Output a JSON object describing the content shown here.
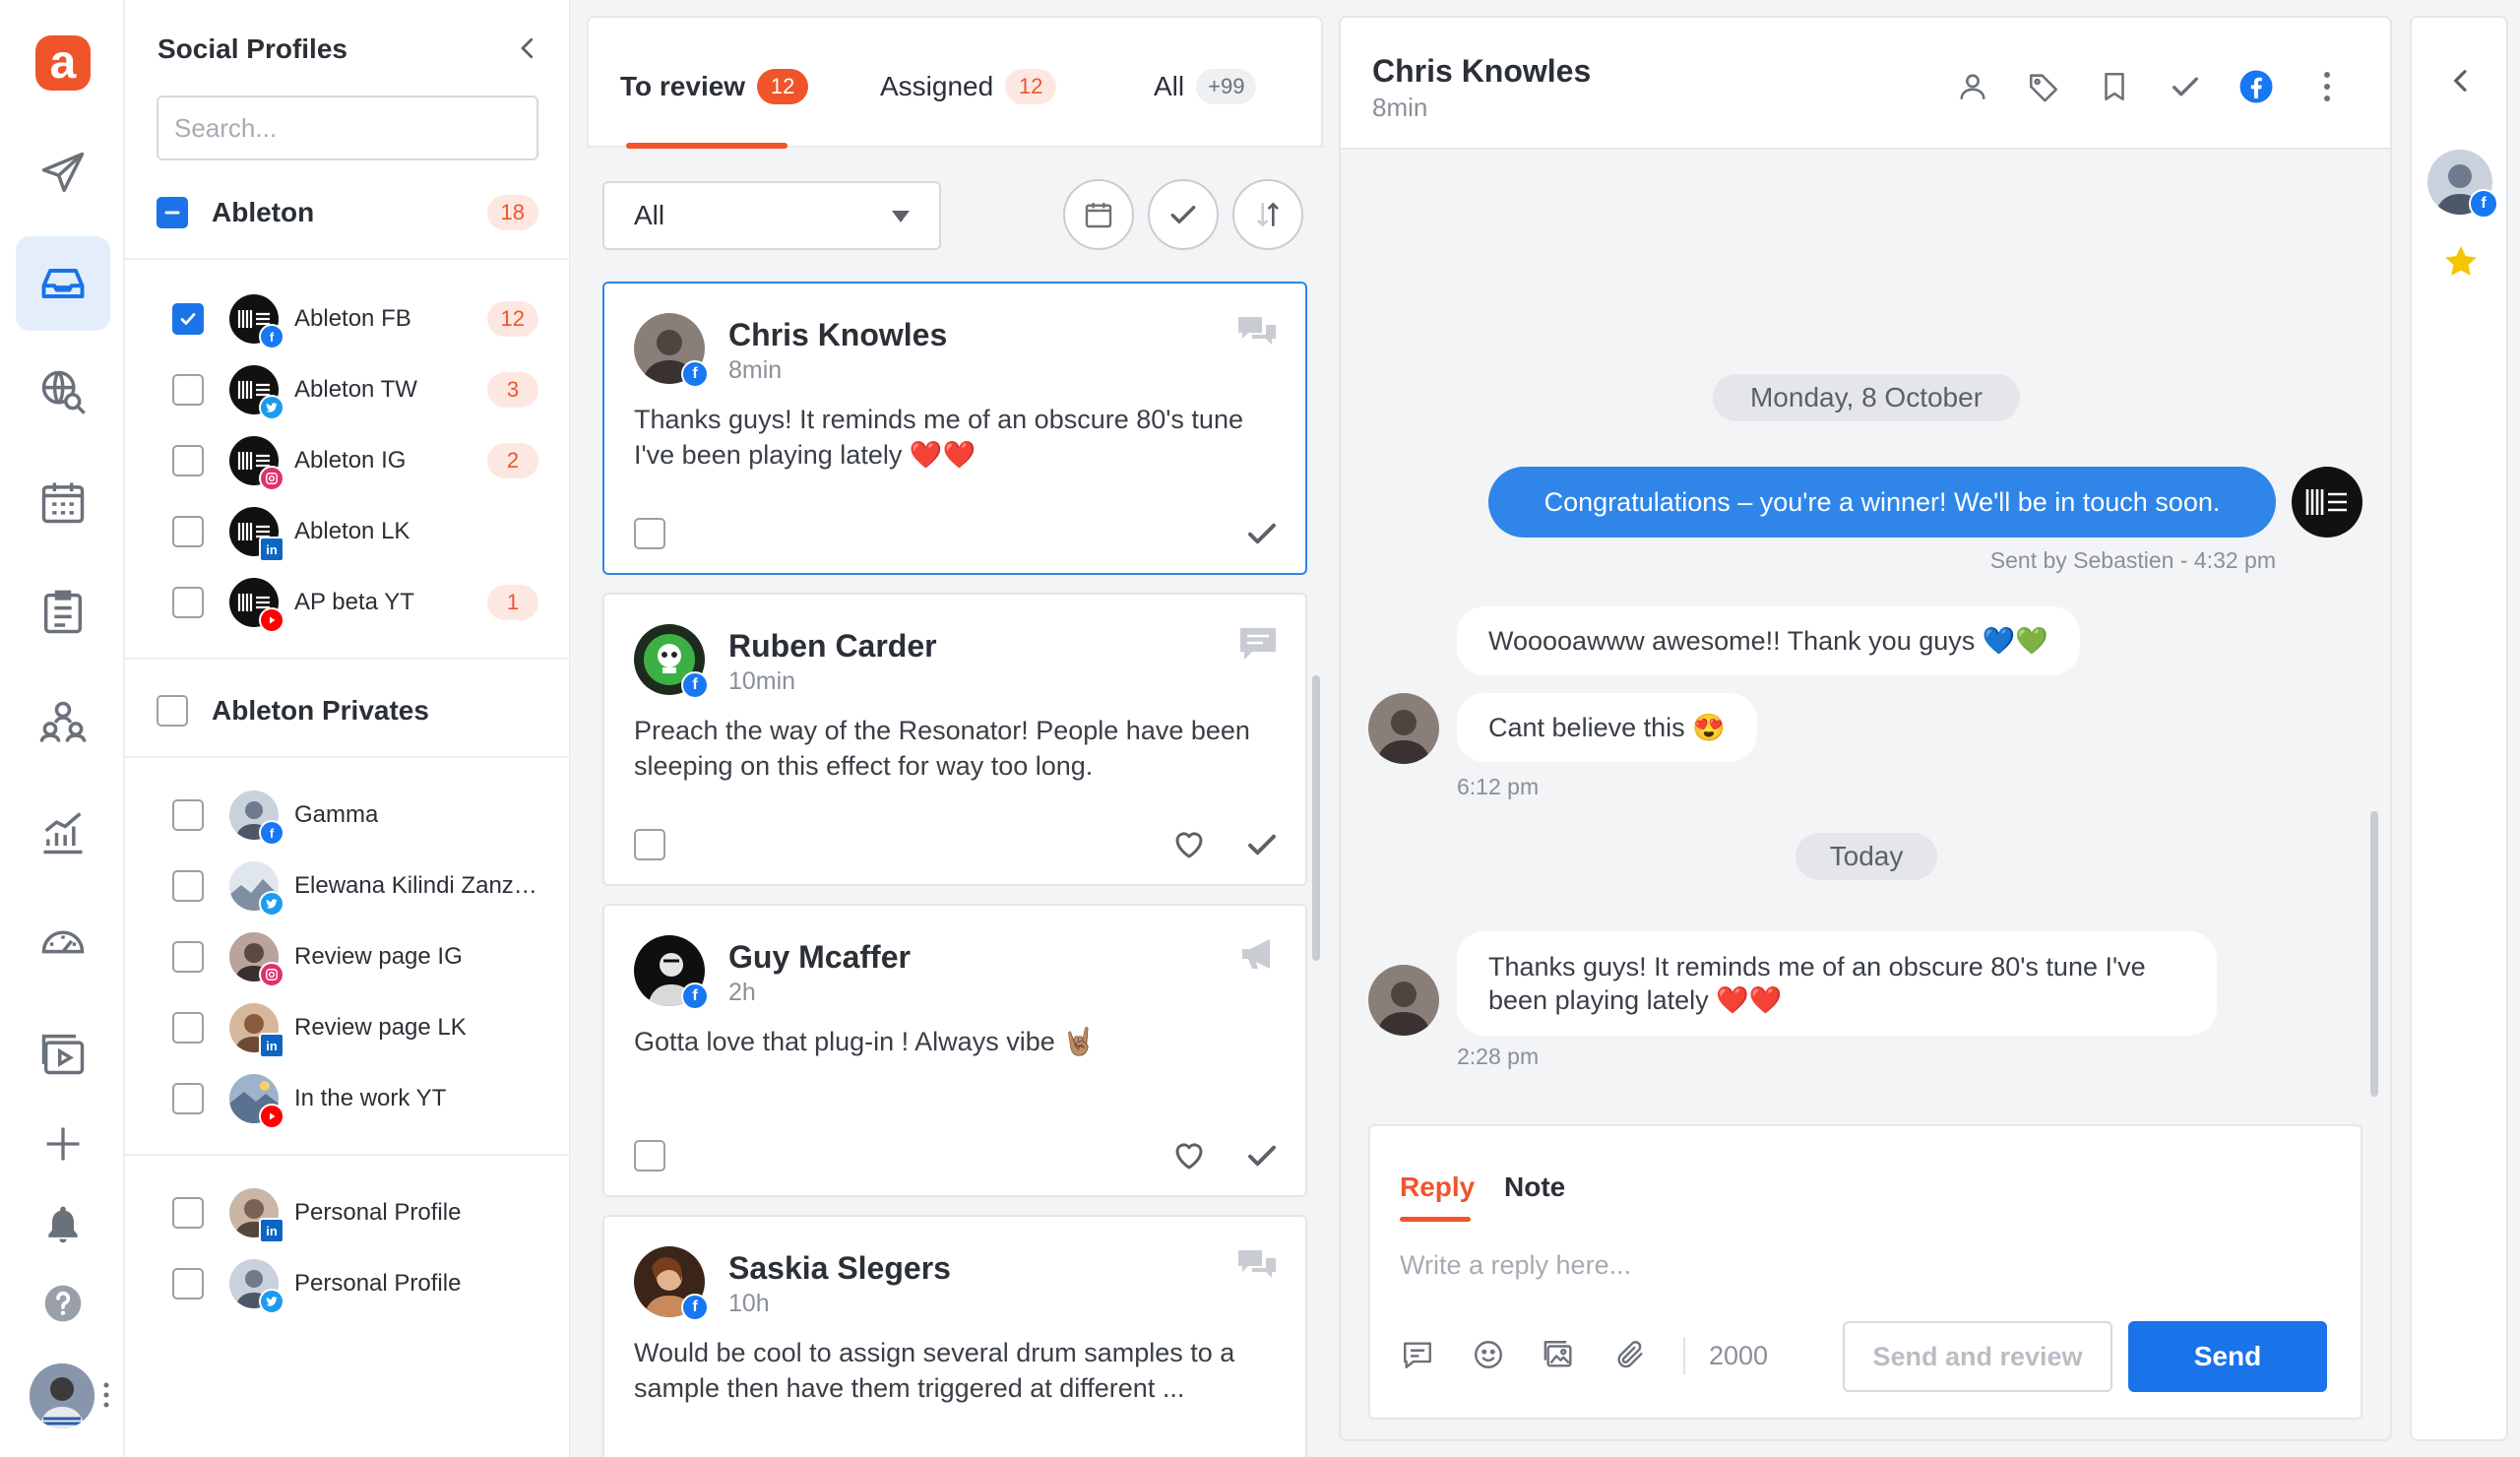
{
  "brand": {
    "logo_letter": "a",
    "accent": "#f0542b",
    "primary": "#1a73e8"
  },
  "rail": {
    "items": [
      {
        "icon": "paper-plane-icon"
      },
      {
        "icon": "inbox-icon",
        "active": true
      },
      {
        "icon": "globe-search-icon"
      },
      {
        "icon": "calendar-icon"
      },
      {
        "icon": "clipboard-list-icon"
      },
      {
        "icon": "team-icon"
      },
      {
        "icon": "bar-chart-icon"
      },
      {
        "icon": "speedometer-icon"
      },
      {
        "icon": "media-library-icon"
      },
      {
        "icon": "plus-icon"
      },
      {
        "icon": "bell-icon"
      },
      {
        "icon": "help-icon"
      }
    ]
  },
  "profiles": {
    "title": "Social Profiles",
    "search_placeholder": "Search...",
    "group1": {
      "name": "Ableton",
      "count": "18"
    },
    "group1_items": [
      {
        "label": "Ableton FB",
        "network": "facebook",
        "badge": "12",
        "checked": true
      },
      {
        "label": "Ableton TW",
        "network": "twitter",
        "badge": "3"
      },
      {
        "label": "Ableton IG",
        "network": "instagram",
        "badge": "2"
      },
      {
        "label": "Ableton LK",
        "network": "linkedin",
        "badge": ""
      },
      {
        "label": "AP beta YT",
        "network": "youtube",
        "badge": "1"
      }
    ],
    "group2": {
      "name": "Ableton Privates"
    },
    "group2_items": [
      {
        "label": "Gamma",
        "network": "facebook"
      },
      {
        "label": "Elewana Kilindi Zanzi...",
        "network": "twitter"
      },
      {
        "label": "Review page IG",
        "network": "instagram"
      },
      {
        "label": "Review page LK",
        "network": "linkedin"
      },
      {
        "label": "In the work YT",
        "network": "youtube"
      }
    ],
    "group3_items": [
      {
        "label": "Personal Profile",
        "network": "linkedin"
      },
      {
        "label": "Personal Profile",
        "network": "twitter"
      }
    ]
  },
  "feed": {
    "tabs": [
      {
        "label": "To review",
        "badge": "12"
      },
      {
        "label": "Assigned",
        "badge": "12"
      },
      {
        "label": "All",
        "badge": "+99"
      }
    ],
    "filter_value": "All",
    "cards": [
      {
        "name": "Chris Knowles",
        "time": "8min",
        "text": "Thanks guys! It reminds me of an obscure 80's tune I've been playing lately ❤️❤️"
      },
      {
        "name": "Ruben Carder",
        "time": "10min",
        "text": "Preach the way of the Resonator! People have been sleeping on this effect for way too long."
      },
      {
        "name": "Guy Mcaffer",
        "time": "2h",
        "text": "Gotta love that plug-in ! Always vibe 🤘🏽"
      },
      {
        "name": "Saskia Slegers",
        "time": "10h",
        "text": "Would be cool to assign several drum samples to a sample then have them triggered at different ..."
      }
    ]
  },
  "conversation": {
    "name": "Chris Knowles",
    "time": "8min",
    "date1": "Monday, 8 October",
    "outgoing": "Congratulations – you're a winner! We'll be in touch soon.",
    "sent_by": "Sent by Sebastien - 4:32 pm",
    "incoming1": "Wooooawww awesome!! Thank you guys 💙💚",
    "incoming2": "Cant believe this 😍",
    "time1": "6:12 pm",
    "date2": "Today",
    "incoming3": "Thanks guys! It reminds me of an obscure 80's tune I've been playing lately ❤️❤️",
    "time2": "2:28 pm"
  },
  "composer": {
    "tab_reply": "Reply",
    "tab_note": "Note",
    "placeholder": "Write a reply here...",
    "count": "2000",
    "send_review": "Send and review",
    "send": "Send"
  }
}
